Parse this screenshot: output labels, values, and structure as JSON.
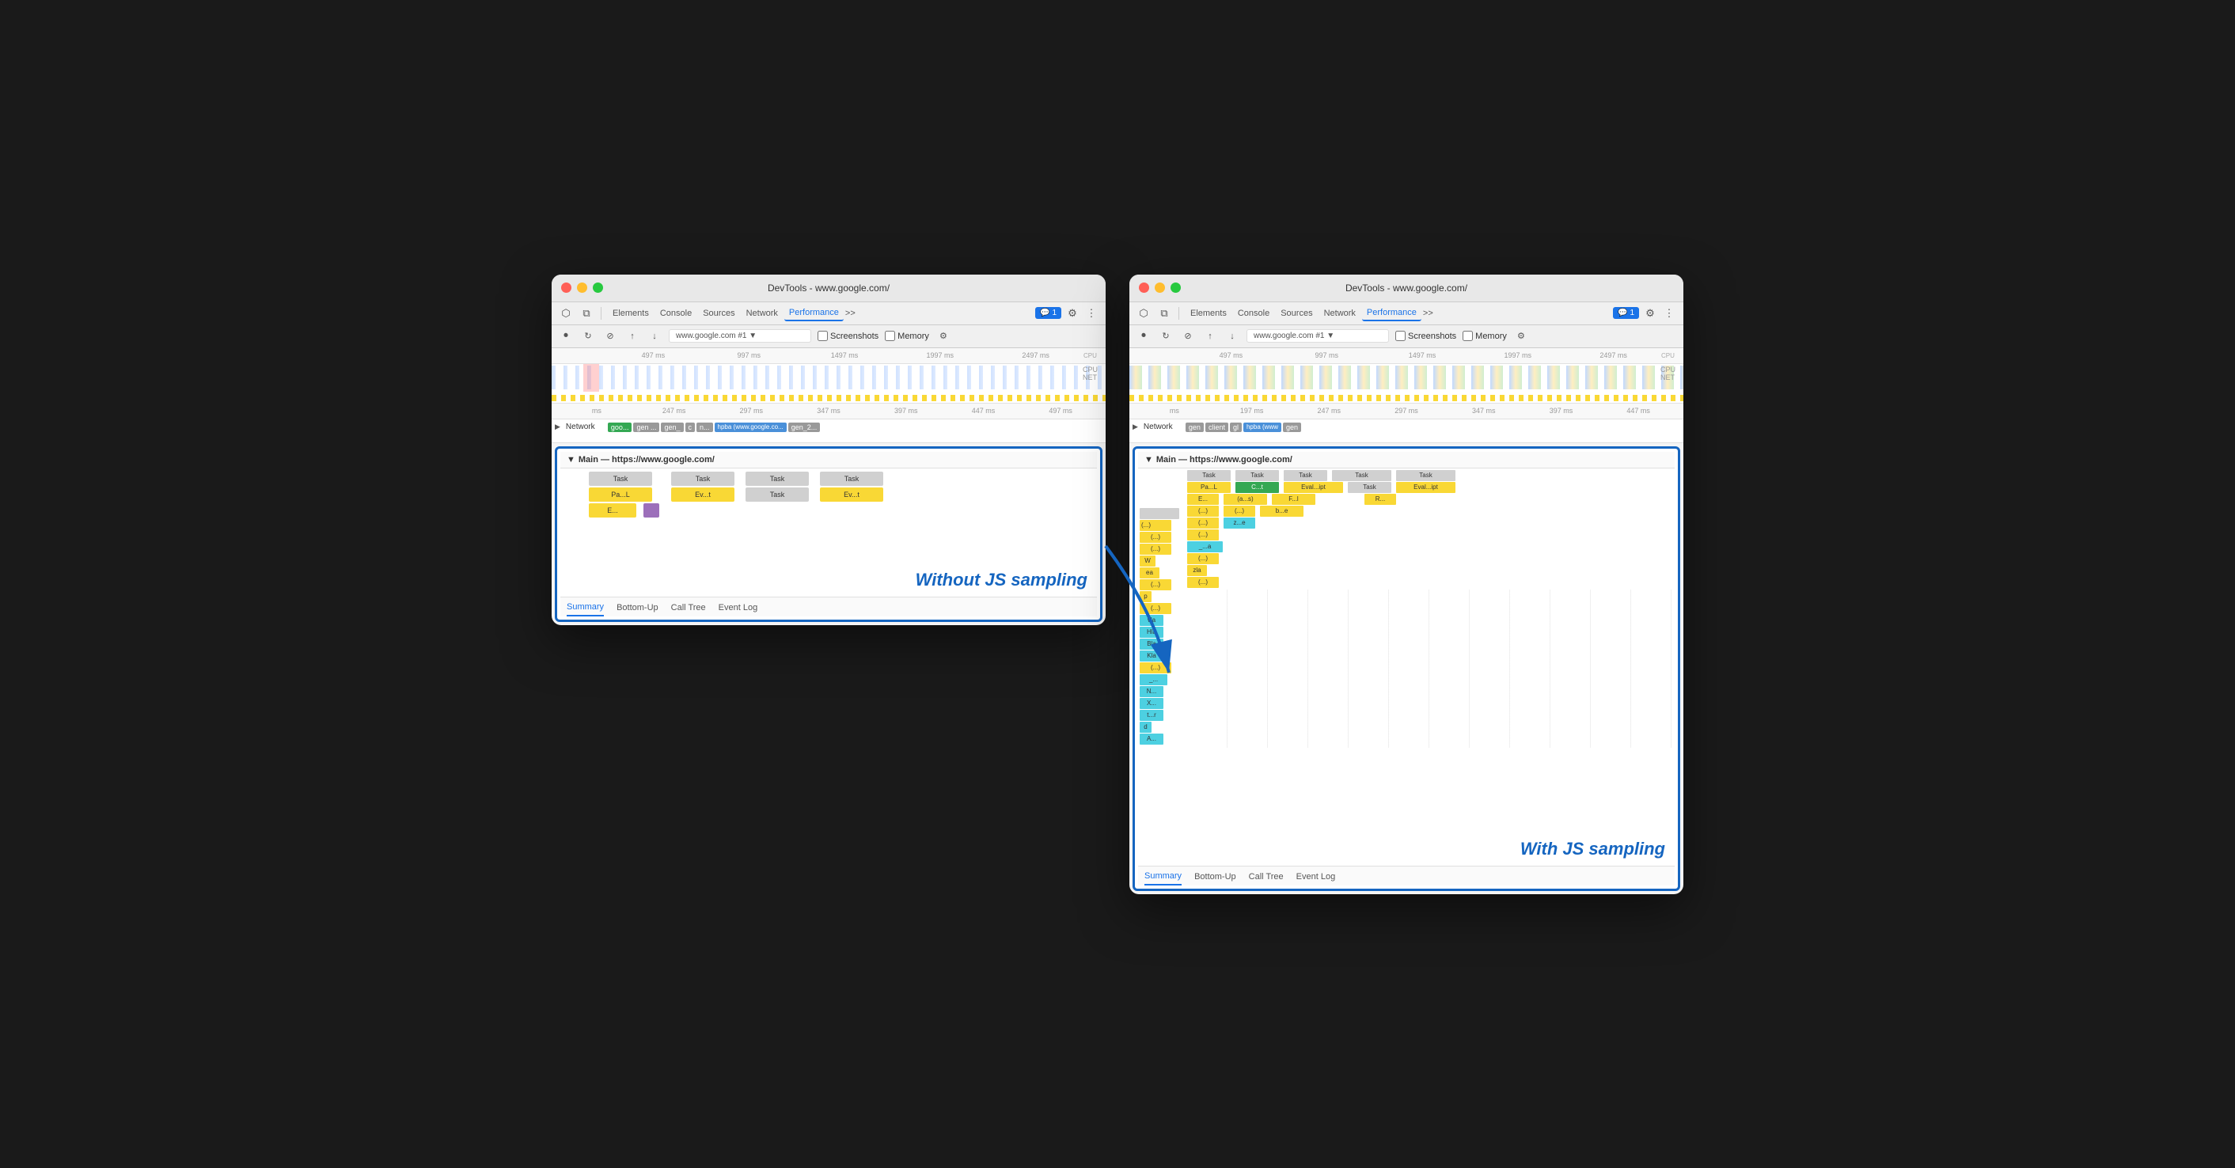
{
  "left_window": {
    "title": "DevTools - www.google.com/",
    "toolbar": {
      "nav_items": [
        "Elements",
        "Console",
        "Sources",
        "Network",
        "Performance"
      ],
      "active_nav": "Performance",
      "more": ">>",
      "address": "www.google.com #1",
      "badge": "1",
      "screenshots_label": "Screenshots",
      "memory_label": "Memory"
    },
    "ruler": {
      "marks": [
        "497 ms",
        "997 ms",
        "1497 ms",
        "1997 ms",
        "2497 ms"
      ]
    },
    "ruler2": {
      "marks": [
        "ms",
        "247 ms",
        "297 ms",
        "347 ms",
        "397 ms",
        "447 ms",
        "497 ms"
      ]
    },
    "network_row": {
      "label": "Network",
      "chips": [
        "goo...",
        "gen ...",
        "gen_",
        "c",
        "n...",
        "hpba (www.google.co...",
        "gen_2..."
      ]
    },
    "main_header": "Main — https://www.google.com/",
    "flame_rows": [
      {
        "blocks": [
          {
            "text": "Task",
            "w": 80,
            "cls": "fb-gray"
          },
          {
            "text": "Task",
            "w": 80,
            "cls": "fb-gray"
          },
          {
            "text": "Task",
            "w": 80,
            "cls": "fb-gray"
          },
          {
            "text": "Task",
            "w": 80,
            "cls": "fb-gray"
          }
        ]
      },
      {
        "blocks": [
          {
            "text": "Pa...L",
            "w": 80,
            "cls": "fb-yellow"
          },
          {
            "text": "Ev...t",
            "w": 80,
            "cls": "fb-yellow"
          },
          {
            "text": "Task",
            "w": 80,
            "cls": "fb-gray"
          },
          {
            "text": "Ev...t",
            "w": 80,
            "cls": "fb-yellow"
          }
        ]
      },
      {
        "blocks": [
          {
            "text": "E...",
            "w": 60,
            "cls": "fb-yellow"
          }
        ]
      }
    ],
    "annotation": "Without JS sampling",
    "tabs": [
      "Summary",
      "Bottom-Up",
      "Call Tree",
      "Event Log"
    ],
    "active_tab": "Summary"
  },
  "right_window": {
    "title": "DevTools - www.google.com/",
    "toolbar": {
      "nav_items": [
        "Elements",
        "Console",
        "Sources",
        "Network",
        "Performance"
      ],
      "active_nav": "Performance",
      "more": ">>",
      "address": "www.google.com #1",
      "badge": "1",
      "screenshots_label": "Screenshots",
      "memory_label": "Memory"
    },
    "ruler": {
      "marks": [
        "497 ms",
        "997 ms",
        "1497 ms",
        "1997 ms",
        "2497 ms"
      ]
    },
    "ruler2": {
      "marks": [
        "ms",
        "197 ms",
        "247 ms",
        "297 ms",
        "347 ms",
        "397 ms",
        "447 ms"
      ]
    },
    "network_row": {
      "label": "Network",
      "chips": [
        "gen",
        "client",
        "gl",
        "hpba (www",
        "gen"
      ]
    },
    "main_header": "Main — https://www.google.com/",
    "flame_rows": [
      {
        "blocks": [
          {
            "text": "Task",
            "w": 60
          },
          {
            "text": "Task",
            "w": 60
          },
          {
            "text": "Task",
            "w": 60
          },
          {
            "text": "Task",
            "w": 80
          },
          {
            "text": "Task",
            "w": 80
          }
        ]
      },
      {
        "blocks": [
          {
            "text": "Pa...L",
            "w": 60,
            "cls": "fb-yellow"
          },
          {
            "text": "C...t",
            "w": 60,
            "cls": "fb-green"
          },
          {
            "text": "Eval...ipt",
            "w": 80,
            "cls": "fb-yellow"
          },
          {
            "text": "Task",
            "w": 80,
            "cls": "fb-gray"
          },
          {
            "text": "Eval...ipt",
            "w": 80,
            "cls": "fb-yellow"
          }
        ]
      },
      {
        "blocks": [
          {
            "text": "E...",
            "w": 50,
            "cls": "fb-yellow"
          },
          {
            "text": "(a...s)",
            "w": 60,
            "cls": "fb-yellow"
          },
          {
            "text": "F...l",
            "w": 60,
            "cls": "fb-yellow"
          },
          {
            "text": "R...",
            "w": 50,
            "cls": "fb-yellow"
          }
        ]
      },
      {
        "blocks": [
          {
            "text": "(...)",
            "w": 50,
            "cls": "fb-yellow"
          },
          {
            "text": "(...)",
            "w": 50,
            "cls": "fb-yellow"
          },
          {
            "text": "b...e",
            "w": 60,
            "cls": "fb-yellow"
          }
        ]
      },
      {
        "blocks": [
          {
            "text": "(...)",
            "w": 50,
            "cls": "fb-yellow"
          },
          {
            "text": "z...e",
            "w": 50,
            "cls": "fb-teal"
          }
        ]
      },
      {
        "blocks": [
          {
            "text": "(...)",
            "w": 50,
            "cls": "fb-yellow"
          }
        ]
      },
      {
        "blocks": [
          {
            "text": "W",
            "w": 20,
            "cls": "fb-yellow"
          },
          {
            "text": "_...a",
            "w": 50,
            "cls": "fb-teal"
          }
        ]
      },
      {
        "blocks": [
          {
            "text": "ea",
            "w": 30,
            "cls": "fb-yellow"
          },
          {
            "text": "(...)",
            "w": 50,
            "cls": "fb-yellow"
          }
        ]
      },
      {
        "blocks": [
          {
            "text": "(...)",
            "w": 50,
            "cls": "fb-yellow"
          }
        ]
      },
      {
        "blocks": [
          {
            "text": "p",
            "w": 15,
            "cls": "fb-yellow"
          },
          {
            "text": "zla",
            "w": 30,
            "cls": "fb-yellow"
          }
        ]
      },
      {
        "blocks": [
          {
            "text": "(...)",
            "w": 50,
            "cls": "fb-yellow"
          }
        ]
      },
      {
        "blocks": [
          {
            "text": "vla",
            "w": 30,
            "cls": "fb-teal"
          }
        ]
      },
      {
        "blocks": [
          {
            "text": "Hla",
            "w": 30,
            "cls": "fb-teal"
          }
        ]
      },
      {
        "blocks": [
          {
            "text": "Bla",
            "w": 30,
            "cls": "fb-teal"
          }
        ]
      },
      {
        "blocks": [
          {
            "text": "Kla",
            "w": 30,
            "cls": "fb-teal"
          }
        ]
      },
      {
        "blocks": [
          {
            "text": "(...)",
            "w": 50,
            "cls": "fb-yellow"
          }
        ]
      },
      {
        "blocks": [
          {
            "text": "_...",
            "w": 35,
            "cls": "fb-teal"
          }
        ]
      },
      {
        "blocks": [
          {
            "text": "N...",
            "w": 30,
            "cls": "fb-teal"
          }
        ]
      },
      {
        "blocks": [
          {
            "text": "X...",
            "w": 30,
            "cls": "fb-teal"
          }
        ]
      },
      {
        "blocks": [
          {
            "text": "t...r",
            "w": 30,
            "cls": "fb-teal"
          }
        ]
      },
      {
        "blocks": [
          {
            "text": "d",
            "w": 15,
            "cls": "fb-teal"
          }
        ]
      },
      {
        "blocks": [
          {
            "text": "A...",
            "w": 30,
            "cls": "fb-teal"
          }
        ]
      }
    ],
    "annotation": "With JS sampling",
    "tabs": [
      "Summary",
      "Bottom-Up",
      "Call Tree",
      "Event Log"
    ],
    "active_tab": "Summary"
  },
  "icons": {
    "cursor": "⬡",
    "layers": "⧉",
    "record": "⏺",
    "refresh": "↻",
    "clear": "⊘",
    "upload": "↑",
    "download": "↓",
    "settings": "⚙",
    "more_vert": "⋮",
    "triangle_down": "▼",
    "triangle_right": "▶"
  }
}
